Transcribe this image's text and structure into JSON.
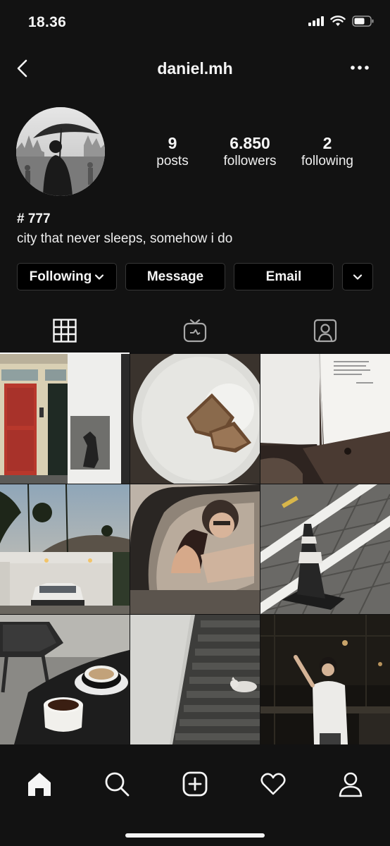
{
  "status_bar": {
    "time": "18.36",
    "icons": [
      "cellular-signal-icon",
      "wifi-icon",
      "battery-icon"
    ]
  },
  "header": {
    "username": "daniel.mh",
    "back_icon": "chevron-left-icon",
    "more_icon": "more-horizontal-icon"
  },
  "profile": {
    "stats": [
      {
        "value": "9",
        "label": "posts"
      },
      {
        "value": "6.850",
        "label": "followers"
      },
      {
        "value": "2",
        "label": "following"
      }
    ],
    "bio_name": "# 777",
    "bio_text": "city that never sleeps, somehow i do"
  },
  "buttons": {
    "following": "Following",
    "message": "Message",
    "email": "Email"
  },
  "tabs": [
    {
      "icon": "grid-icon",
      "active": true
    },
    {
      "icon": "igtv-icon",
      "active": false
    },
    {
      "icon": "tagged-icon",
      "active": false
    }
  ],
  "posts": [
    "red-door-street-photo",
    "bread-on-plate-photo",
    "open-book-photo",
    "palm-trees-car-photo",
    "car-mirror-selfie-photo",
    "traffic-cone-photo",
    "coffee-cups-photo",
    "stairs-cat-photo",
    "night-portrait-photo"
  ],
  "bottom_nav": [
    "home-icon",
    "search-icon",
    "new-post-icon",
    "activity-heart-icon",
    "profile-icon"
  ],
  "colors": {
    "background": "#121212",
    "text": "#f5f5f5",
    "button_bg": "#000000",
    "button_border": "#363636"
  }
}
